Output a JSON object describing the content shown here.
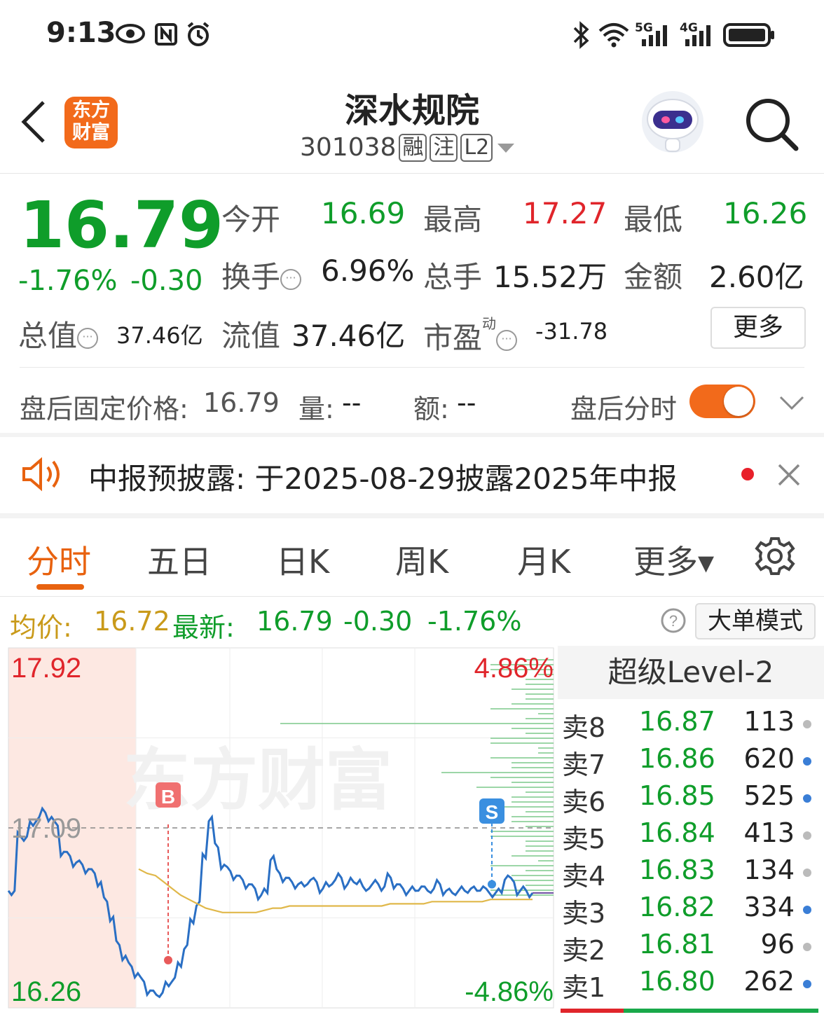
{
  "status_bar": {
    "time": "9:13",
    "icons": [
      "eye-icon",
      "nfc-icon",
      "alarm-icon",
      "bluetooth-icon",
      "wifi-icon",
      "signal-5g-icon",
      "signal-4g-icon",
      "battery-icon"
    ],
    "net1": "5G",
    "net2": "4G"
  },
  "header": {
    "stock_name": "深水规院",
    "stock_code": "301038",
    "tags": [
      "融",
      "注",
      "L2"
    ],
    "logo_text": "东方财富",
    "brand_color": "#f26a1b"
  },
  "quote": {
    "last_price": "16.79",
    "change_pct": "-1.76%",
    "change_abs": "-0.30",
    "open_label": "今开",
    "open_value": "16.69",
    "high_label": "最高",
    "high_value": "17.27",
    "low_label": "最低",
    "low_value": "16.26",
    "turnover_label": "换手",
    "turnover_value": "6.96%",
    "volume_label": "总手",
    "volume_value": "15.52万",
    "amount_label": "金额",
    "amount_value": "2.60亿",
    "mktcap_label": "总值",
    "mktcap_value": "37.46亿",
    "float_label": "流值",
    "float_value": "37.46亿",
    "pe_label": "市盈",
    "pe_super": "动",
    "pe_value": "-31.78",
    "more_label": "更多"
  },
  "after_hours": {
    "price_label": "盘后固定价格:",
    "price_value": "16.79",
    "vol_label": "量:",
    "vol_value": "--",
    "amt_label": "额:",
    "amt_value": "--",
    "toggle_label": "盘后分时",
    "toggle_on": true
  },
  "notice": {
    "text": "中报预披露: 于2025-08-29披露2025年中报"
  },
  "tabs": [
    {
      "label": "分时",
      "active": true
    },
    {
      "label": "五日"
    },
    {
      "label": "日K"
    },
    {
      "label": "周K"
    },
    {
      "label": "月K"
    },
    {
      "label": "更多▾"
    }
  ],
  "chart_header": {
    "avg_label": "均价:",
    "avg_value": "16.72",
    "latest_label": "最新:",
    "latest_value": "16.79",
    "latest_chg": "-0.30",
    "latest_pct": "-1.76%",
    "big_order_label": "大单模式"
  },
  "chart_data": {
    "type": "line",
    "title": "",
    "ylim": [
      16.26,
      17.92
    ],
    "ytick_labels": {
      "max": "17.92",
      "prev_close": "17.09",
      "min": "16.26"
    },
    "pct_labels": {
      "max": "4.86%",
      "min": "-4.86%"
    },
    "prev_close": 17.09,
    "watermark": "东方财富",
    "markers": [
      {
        "label": "B",
        "price": 16.48
      },
      {
        "label": "S",
        "price": 16.83
      }
    ],
    "series": [
      {
        "name": "最新",
        "color": "#2a6fc4",
        "values": [
          16.8,
          16.8,
          17.05,
          17.05,
          17.1,
          17.14,
          17.16,
          17.14,
          17.1,
          16.98,
          16.96,
          16.93,
          16.92,
          16.9,
          16.88,
          16.84,
          16.75,
          16.68,
          16.55,
          16.5,
          16.45,
          16.42,
          16.38,
          16.34,
          16.32,
          16.33,
          16.36,
          16.4,
          16.45,
          16.55,
          16.65,
          16.75,
          16.95,
          17.14,
          17.0,
          16.92,
          16.89,
          16.87,
          16.85,
          16.83,
          16.81,
          16.78,
          16.79,
          16.96,
          16.88,
          16.86,
          16.84,
          16.83,
          16.82,
          16.85,
          16.84,
          16.81,
          16.82,
          16.85,
          16.86,
          16.83,
          16.84,
          16.85,
          16.8,
          16.83,
          16.83,
          16.82,
          16.86,
          16.83,
          16.81,
          16.8,
          16.8,
          16.82,
          16.8,
          16.81,
          16.83,
          16.8,
          16.79,
          16.8,
          16.8,
          16.81,
          16.8,
          16.82,
          16.79,
          16.79,
          16.79,
          16.87,
          16.84,
          16.8,
          16.8,
          16.79
        ]
      },
      {
        "name": "均价",
        "color": "#e0b84a",
        "values": [
          16.9,
          16.88,
          16.87,
          16.84,
          16.81,
          16.78,
          16.76,
          16.74,
          16.72,
          16.71,
          16.7,
          16.7,
          16.7,
          16.7,
          16.7,
          16.71,
          16.72,
          16.72,
          16.73,
          16.73,
          16.73,
          16.73,
          16.73,
          16.73,
          16.73,
          16.73,
          16.73,
          16.73,
          16.73,
          16.73,
          16.74,
          16.74,
          16.74,
          16.74,
          16.74,
          16.75,
          16.75,
          16.75,
          16.75,
          16.75,
          16.75,
          16.75,
          16.76,
          16.76,
          16.76,
          16.76,
          16.76,
          16.76
        ]
      }
    ]
  },
  "level2": {
    "title": "超级Level-2",
    "rows": [
      {
        "label": "卖8",
        "price": "16.87",
        "qty": "113",
        "dot": "#bbbbbb"
      },
      {
        "label": "卖7",
        "price": "16.86",
        "qty": "620",
        "dot": "#3a7ed6"
      },
      {
        "label": "卖6",
        "price": "16.85",
        "qty": "525",
        "dot": "#3a7ed6"
      },
      {
        "label": "卖5",
        "price": "16.84",
        "qty": "413",
        "dot": "#bbbbbb"
      },
      {
        "label": "卖4",
        "price": "16.83",
        "qty": "134",
        "dot": "#bbbbbb"
      },
      {
        "label": "卖3",
        "price": "16.82",
        "qty": "334",
        "dot": "#3a7ed6"
      },
      {
        "label": "卖2",
        "price": "16.81",
        "qty": "96",
        "dot": "#bbbbbb"
      },
      {
        "label": "卖1",
        "price": "16.80",
        "qty": "262",
        "dot": "#3a7ed6"
      }
    ]
  }
}
